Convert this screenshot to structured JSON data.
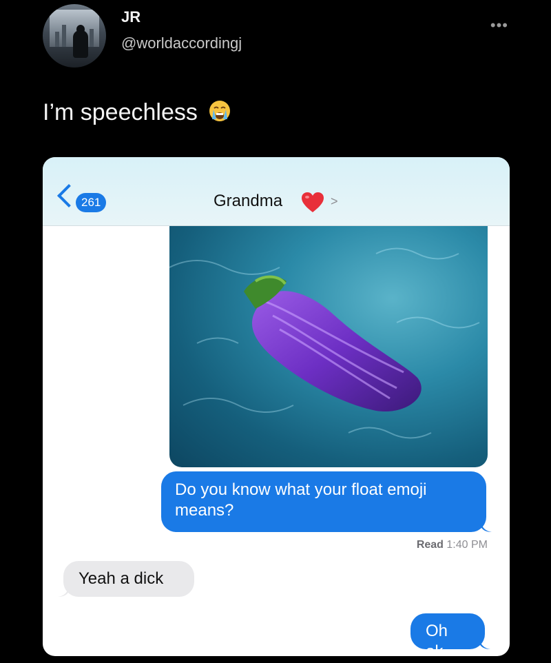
{
  "tweet": {
    "author_name": "JR",
    "author_handle": "@worldaccordingj",
    "more_icon": "more-icon",
    "text": "I’m speechless",
    "emoji": "😭"
  },
  "conversation": {
    "back_badge": "261",
    "contact_name": "Grandma",
    "contact_emoji": "heart-icon",
    "messages": [
      {
        "from": "me",
        "text": "Do you know what your float emoji means?"
      },
      {
        "from": "them",
        "text": "Yeah a dick"
      },
      {
        "from": "me",
        "text": "Oh ok"
      }
    ],
    "read_label": "Read",
    "read_time": "1:40 PM"
  },
  "colors": {
    "bubble_blue": "#1a7ae6",
    "bubble_gray": "#e9e9eb",
    "eggplant": "#6b2bbd"
  }
}
